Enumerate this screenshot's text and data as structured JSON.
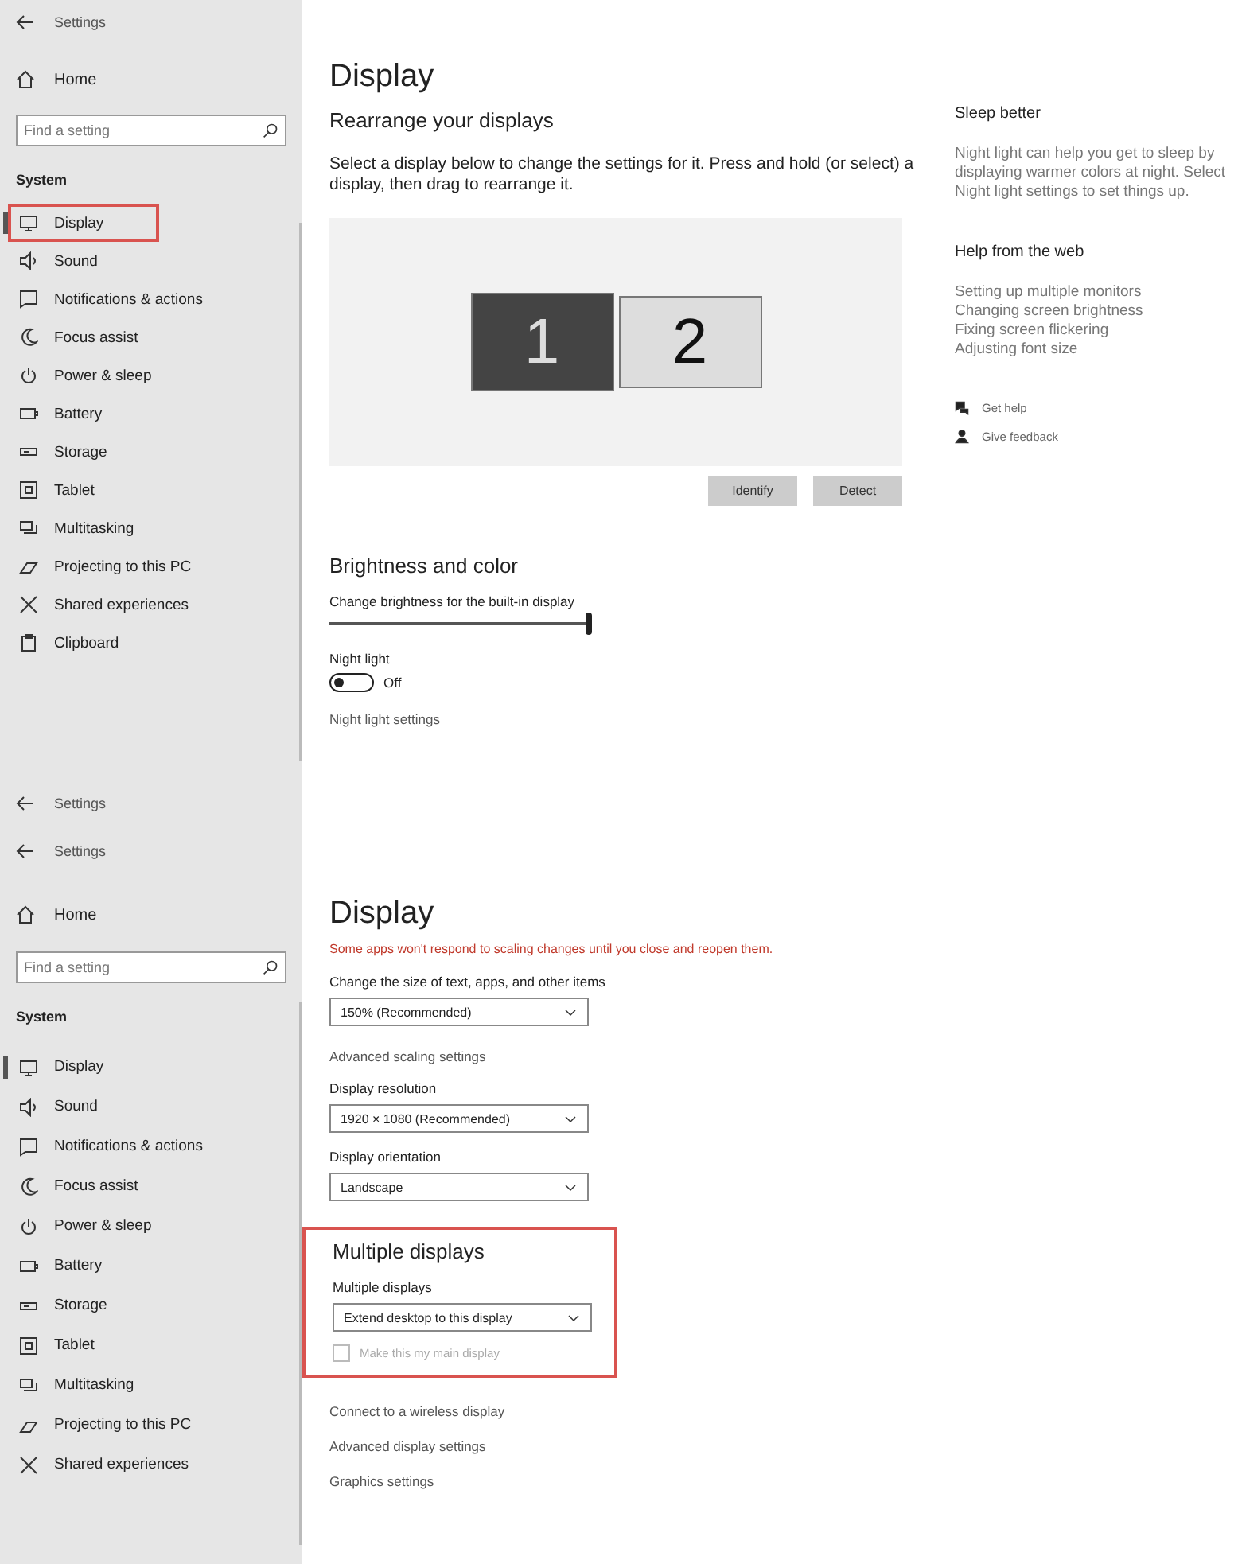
{
  "panels": [
    {
      "kind": "arrange",
      "sidebar": {
        "back_rows": [
          "Settings"
        ],
        "home": "Home",
        "search": {
          "placeholder": "Find a setting"
        },
        "section": "System",
        "items": [
          {
            "label": "Display",
            "selected": true,
            "highlighted": true
          },
          {
            "label": "Sound",
            "selected": false,
            "highlighted": false
          },
          {
            "label": "Notifications & actions",
            "selected": false,
            "highlighted": false
          },
          {
            "label": "Focus assist",
            "selected": false,
            "highlighted": false
          },
          {
            "label": "Power & sleep",
            "selected": false,
            "highlighted": false
          },
          {
            "label": "Battery",
            "selected": false,
            "highlighted": false
          },
          {
            "label": "Storage",
            "selected": false,
            "highlighted": false
          },
          {
            "label": "Tablet",
            "selected": false,
            "highlighted": false
          },
          {
            "label": "Multitasking",
            "selected": false,
            "highlighted": false
          },
          {
            "label": "Projecting to this PC",
            "selected": false,
            "highlighted": false
          },
          {
            "label": "Shared experiences",
            "selected": false,
            "highlighted": false
          },
          {
            "label": "Clipboard",
            "selected": false,
            "highlighted": false
          }
        ]
      },
      "content": {
        "title": "Display",
        "heading": "Rearrange your displays",
        "description": "Select a display below to change the settings for it. Press and hold (or select) a display, then drag to rearrange it.",
        "monitors": [
          {
            "label": "1",
            "selected": true
          },
          {
            "label": "2",
            "selected": false
          }
        ],
        "buttons": [
          "Identify",
          "Detect"
        ],
        "brightness": {
          "heading": "Brightness and color",
          "label": "Change brightness for the built-in display",
          "level": 1.0
        },
        "night_light": {
          "label": "Night light",
          "on": false,
          "state_text": "Off"
        },
        "link": "Night light settings"
      },
      "aside": {
        "sleep_title": "Sleep better",
        "sleep_text": "Night light can help you get to sleep by displaying warmer colors at night. Select Night light settings to set things up.",
        "help_title": "Help from the web",
        "help_links": [
          "Setting up multiple monitors",
          "Changing screen brightness",
          "Fixing screen flickering",
          "Adjusting font size"
        ],
        "actions": [
          "Get help",
          "Give feedback"
        ]
      }
    },
    {
      "kind": "scale",
      "sidebar": {
        "back_rows": [
          "Settings",
          "Settings"
        ],
        "home": "Home",
        "search": {
          "placeholder": "Find a setting"
        },
        "section": "System",
        "items": [
          {
            "label": "Display",
            "selected": true,
            "highlighted": false
          },
          {
            "label": "Sound",
            "selected": false,
            "highlighted": false
          },
          {
            "label": "Notifications & actions",
            "selected": false,
            "highlighted": false
          },
          {
            "label": "Focus assist",
            "selected": false,
            "highlighted": false
          },
          {
            "label": "Power & sleep",
            "selected": false,
            "highlighted": false
          },
          {
            "label": "Battery",
            "selected": false,
            "highlighted": false
          },
          {
            "label": "Storage",
            "selected": false,
            "highlighted": false
          },
          {
            "label": "Tablet",
            "selected": false,
            "highlighted": false
          },
          {
            "label": "Multitasking",
            "selected": false,
            "highlighted": false
          },
          {
            "label": "Projecting to this PC",
            "selected": false,
            "highlighted": false
          },
          {
            "label": "Shared experiences",
            "selected": false,
            "highlighted": false
          }
        ]
      },
      "content": {
        "title": "Display",
        "warning": "Some apps won't respond to scaling changes until you close and reopen them.",
        "settings": [
          {
            "kind": "dropdown",
            "label": "Change the size of text, apps, and other items",
            "value": "150% (Recommended)"
          },
          {
            "kind": "link",
            "label": "Advanced scaling settings"
          },
          {
            "kind": "dropdown",
            "label": "Display resolution",
            "value": "1920 × 1080 (Recommended)"
          },
          {
            "kind": "dropdown",
            "label": "Display orientation",
            "value": "Landscape"
          }
        ],
        "section": {
          "heading": "Multiple displays",
          "highlighted": true,
          "label": "Multiple displays",
          "value": "Extend desktop to this display",
          "checkbox": {
            "label": "Make this my main display",
            "checked": false,
            "disabled": true
          }
        },
        "links": [
          "Connect to a wireless display",
          "Advanced display settings",
          "Graphics settings"
        ]
      }
    }
  ]
}
